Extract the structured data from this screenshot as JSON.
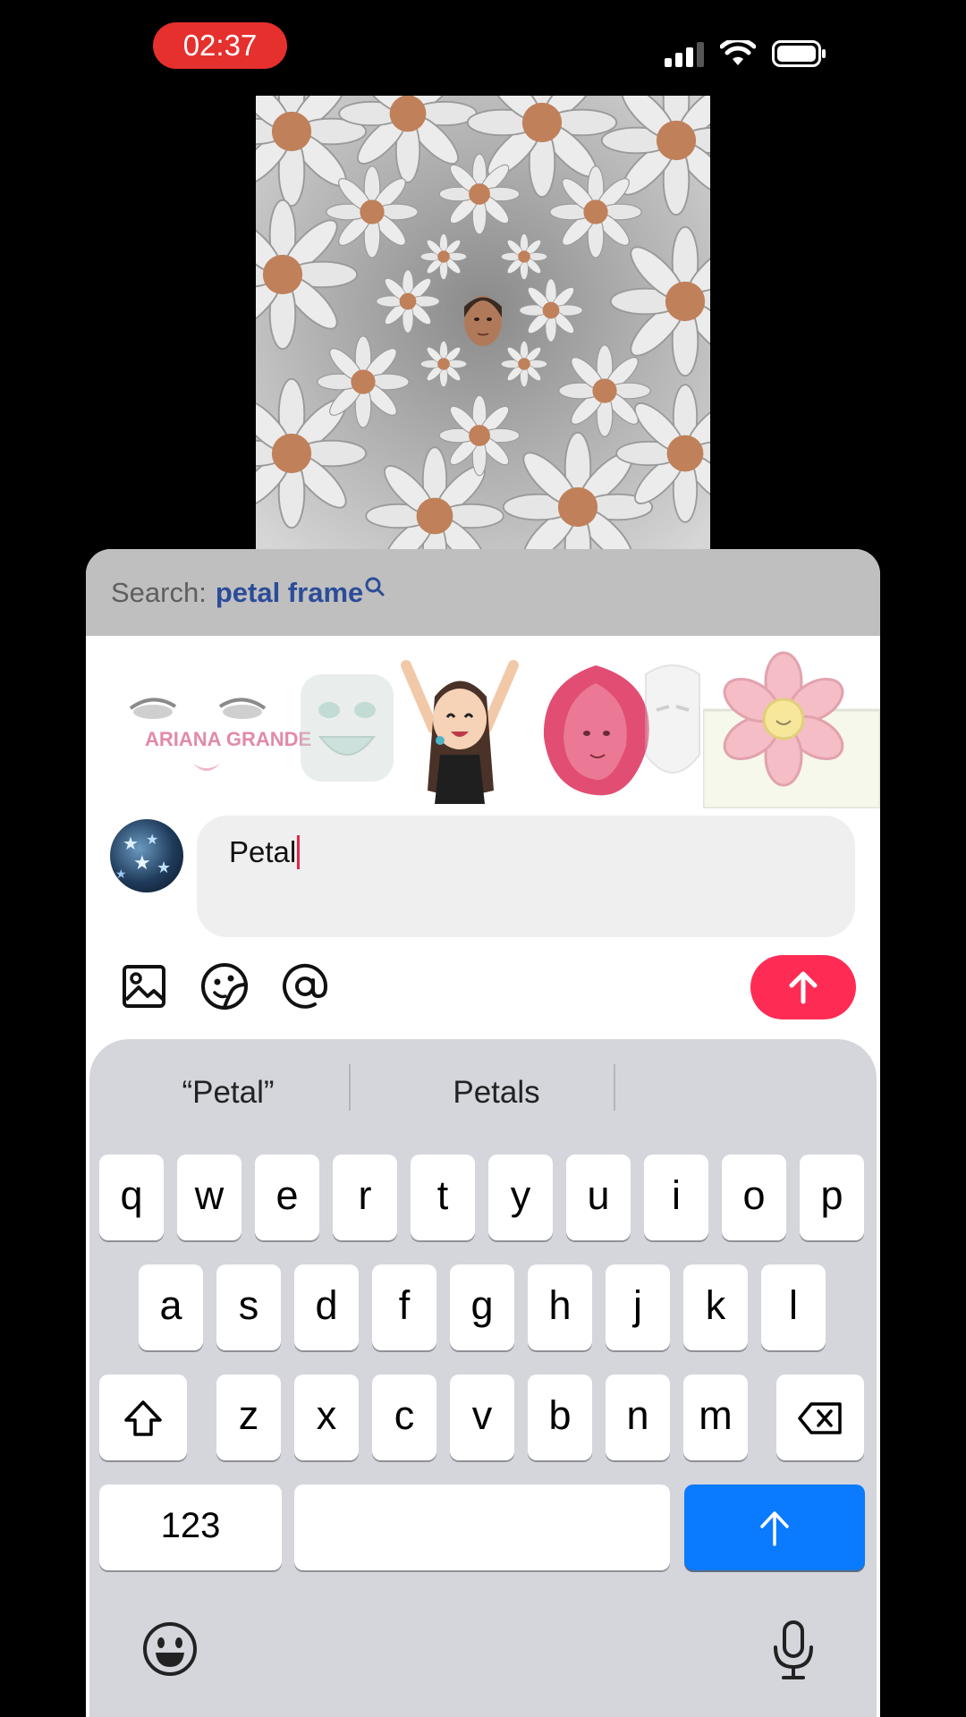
{
  "status_bar": {
    "time": "02:37"
  },
  "search": {
    "prefix": "Search:",
    "term": "petal frame"
  },
  "stickers": [
    {
      "icon": "ariana-grande-eyes-logo-sticker",
      "text": "ARIANA GRANDE"
    },
    {
      "icon": "smiling-face-sticker"
    },
    {
      "icon": "cartoon-girl-sticker"
    },
    {
      "icon": "rose-petal-face-sticker"
    },
    {
      "icon": "mask-sticker"
    },
    {
      "icon": "pixel-flower-sticker"
    }
  ],
  "composer": {
    "value": "Petal"
  },
  "toolbar": {
    "icons": [
      "image-icon",
      "sticker-icon",
      "mention-icon"
    ],
    "send": "arrow-up-icon"
  },
  "keyboard": {
    "suggestions": [
      "“Petal”",
      "Petals",
      ""
    ],
    "row1": [
      "q",
      "w",
      "e",
      "r",
      "t",
      "y",
      "u",
      "i",
      "o",
      "p"
    ],
    "row2": [
      "a",
      "s",
      "d",
      "f",
      "g",
      "h",
      "j",
      "k",
      "l"
    ],
    "row3": [
      "z",
      "x",
      "c",
      "v",
      "b",
      "n",
      "m"
    ],
    "numbers_key": "123",
    "colors": {
      "accent": "#0a7aff",
      "send": "#fe2c55",
      "recording": "#e5302d"
    }
  }
}
